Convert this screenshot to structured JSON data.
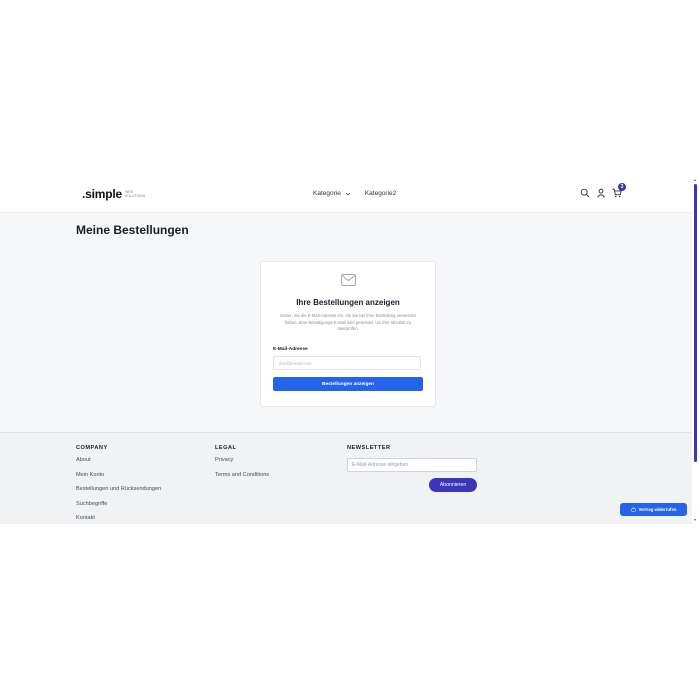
{
  "header": {
    "logo_text": ".simple",
    "logo_sub": "Web Solutions",
    "nav": [
      "Kategorie",
      "Kategorie2"
    ],
    "cart_count": "3",
    "icons": [
      "search-icon",
      "user-icon",
      "cart-icon"
    ]
  },
  "main": {
    "page_title": "Meine Bestellungen",
    "card": {
      "icon": "mail-icon",
      "title": "Ihre Bestellungen anzeigen",
      "description": "Geben Sie die E-Mail-Adresse ein, die Sie bei Ihrer Bestellung verwendet haben. Eine Bestätigungs-E-Mail wird gesendet, um Ihre Identität zu überprüfen.",
      "email_label": "E-Mail-Adresse",
      "email_placeholder": "ihre@email.com",
      "email_value": "",
      "submit_label": "Bestellungen anzeigen"
    }
  },
  "footer": {
    "company": {
      "heading": "COMPANY",
      "links": [
        "About",
        "Mein Konto",
        "Bestellungen und Rücksendungen",
        "Suchbegriffe",
        "Kontakt"
      ]
    },
    "legal": {
      "heading": "LEGAL",
      "links": [
        "Privacy",
        "Terms and Conditions"
      ]
    },
    "newsletter": {
      "heading": "NEWSLETTER",
      "placeholder": "E-Mail-Adresse eingeben",
      "button_label": "Abonnieren"
    }
  },
  "revoke_button_label": "Vertrag widerrufen",
  "colors": {
    "primary_blue": "#2563eb",
    "accent_purple": "#3b35b8",
    "page_bg": "#f6f7f9"
  }
}
